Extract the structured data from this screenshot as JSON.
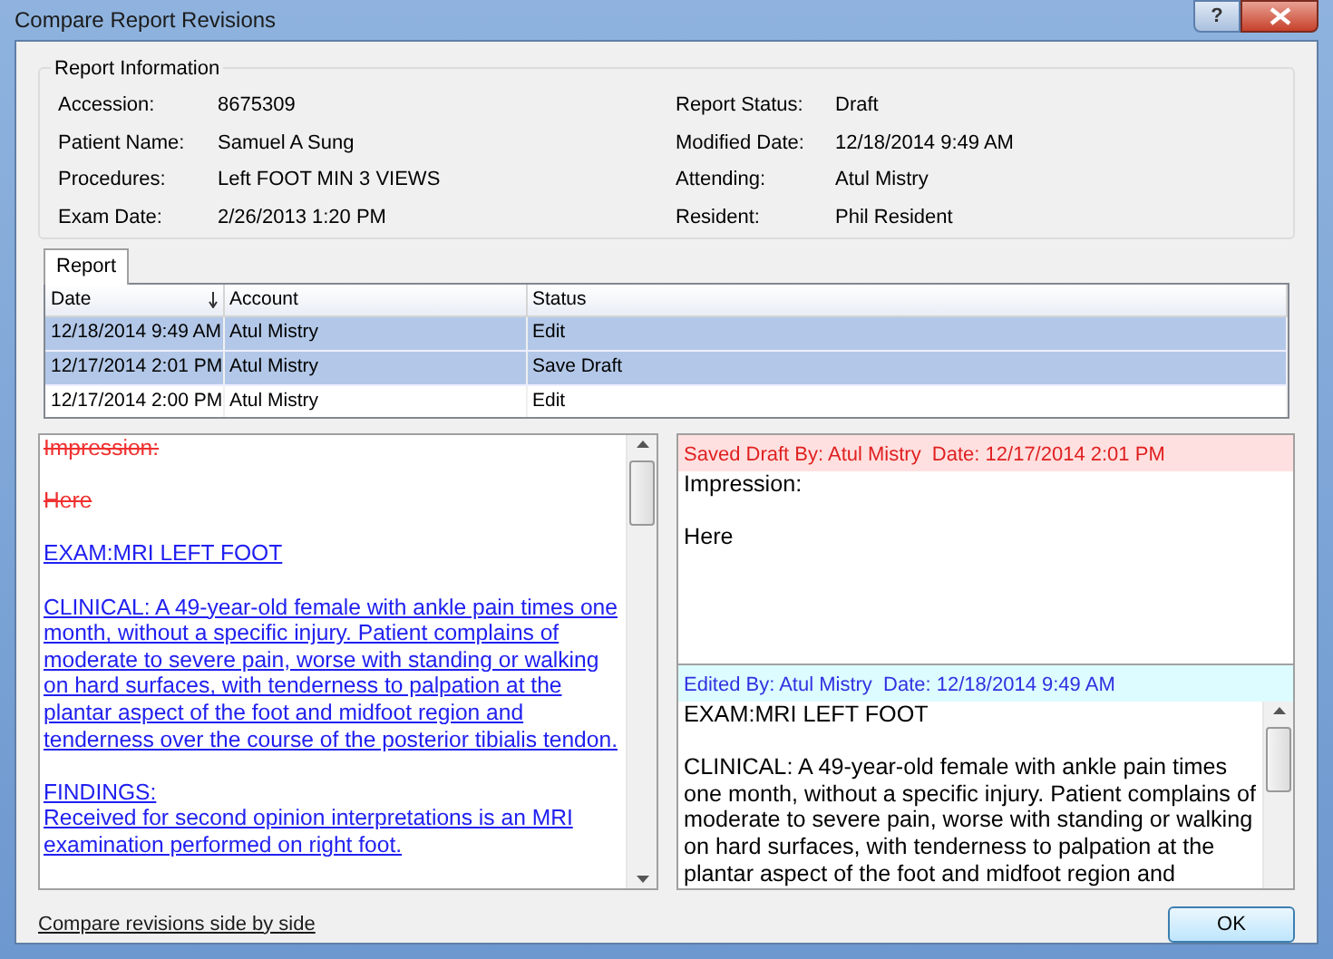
{
  "window": {
    "title": "Compare Report Revisions",
    "help_button": "?"
  },
  "report_info": {
    "title": "Report Information",
    "left_fields": [
      {
        "label": "Accession:",
        "value": "8675309"
      },
      {
        "label": "Patient Name:",
        "value": "Samuel A Sung"
      },
      {
        "label": "Procedures:",
        "value": "Left FOOT MIN 3 VIEWS"
      },
      {
        "label": "Exam Date:",
        "value": "2/26/2013 1:20 PM"
      }
    ],
    "right_fields": [
      {
        "label": "Report Status:",
        "value": "Draft"
      },
      {
        "label": "Modified Date:",
        "value": "12/18/2014 9:49 AM"
      },
      {
        "label": "Attending:",
        "value": "Atul Mistry"
      },
      {
        "label": "Resident:",
        "value": "Phil Resident"
      }
    ]
  },
  "tabs": [
    {
      "label": "Report",
      "selected": true
    }
  ],
  "table": {
    "columns": [
      {
        "label": "Date",
        "sorted": true
      },
      {
        "label": "Account",
        "sorted": false
      },
      {
        "label": "Status",
        "sorted": false
      }
    ],
    "rows": [
      {
        "cells": [
          "12/18/2014 9:49 AM",
          "Atul Mistry",
          "Edit"
        ],
        "selected": true
      },
      {
        "cells": [
          "12/17/2014 2:01 PM",
          "Atul Mistry",
          "Save Draft"
        ],
        "selected": true
      },
      {
        "cells": [
          "12/17/2014 2:00 PM",
          "Atul Mistry",
          "Edit"
        ],
        "selected": false
      }
    ]
  },
  "diff_view": {
    "paragraphs": [
      {
        "kind": "deleted",
        "lines": [
          "Impression:"
        ]
      },
      {
        "kind": "deleted",
        "lines": [
          "Here"
        ]
      },
      {
        "kind": "inserted",
        "lines": [
          "EXAM:MRI LEFT FOOT"
        ]
      },
      {
        "kind": "inserted",
        "lines": [
          "CLINICAL: A 49-year-old female with ankle pain times one month, without a specific injury. Patient complains of moderate to severe pain, worse with standing or walking on hard surfaces, with tenderness to palpation at the plantar aspect of the foot and midfoot region and tenderness over the course of the posterior tibialis tendon."
        ]
      },
      {
        "kind": "inserted",
        "lines": [
          "FINDINGS:",
          "Received for second opinion interpretations is an MRI examination performed on right foot."
        ]
      }
    ]
  },
  "revisions": [
    {
      "kind": "saved_draft",
      "header": "Saved Draft By: Atul Mistry  Date: 12/17/2014 2:01 PM",
      "scrollbar": false,
      "paragraphs": [
        "Impression:",
        "Here"
      ]
    },
    {
      "kind": "edited",
      "header": "Edited By: Atul Mistry  Date: 12/18/2014 9:49 AM",
      "scrollbar": true,
      "paragraphs": [
        "EXAM:MRI LEFT FOOT",
        "CLINICAL: A 49-year-old female with ankle pain times one month, without a specific injury. Patient complains of moderate to severe pain, worse with standing or walking on hard surfaces, with tenderness to palpation at the plantar aspect of the foot and midfoot region and"
      ]
    }
  ],
  "footer": {
    "link": "Compare revisions side by side",
    "ok_button": "OK"
  }
}
